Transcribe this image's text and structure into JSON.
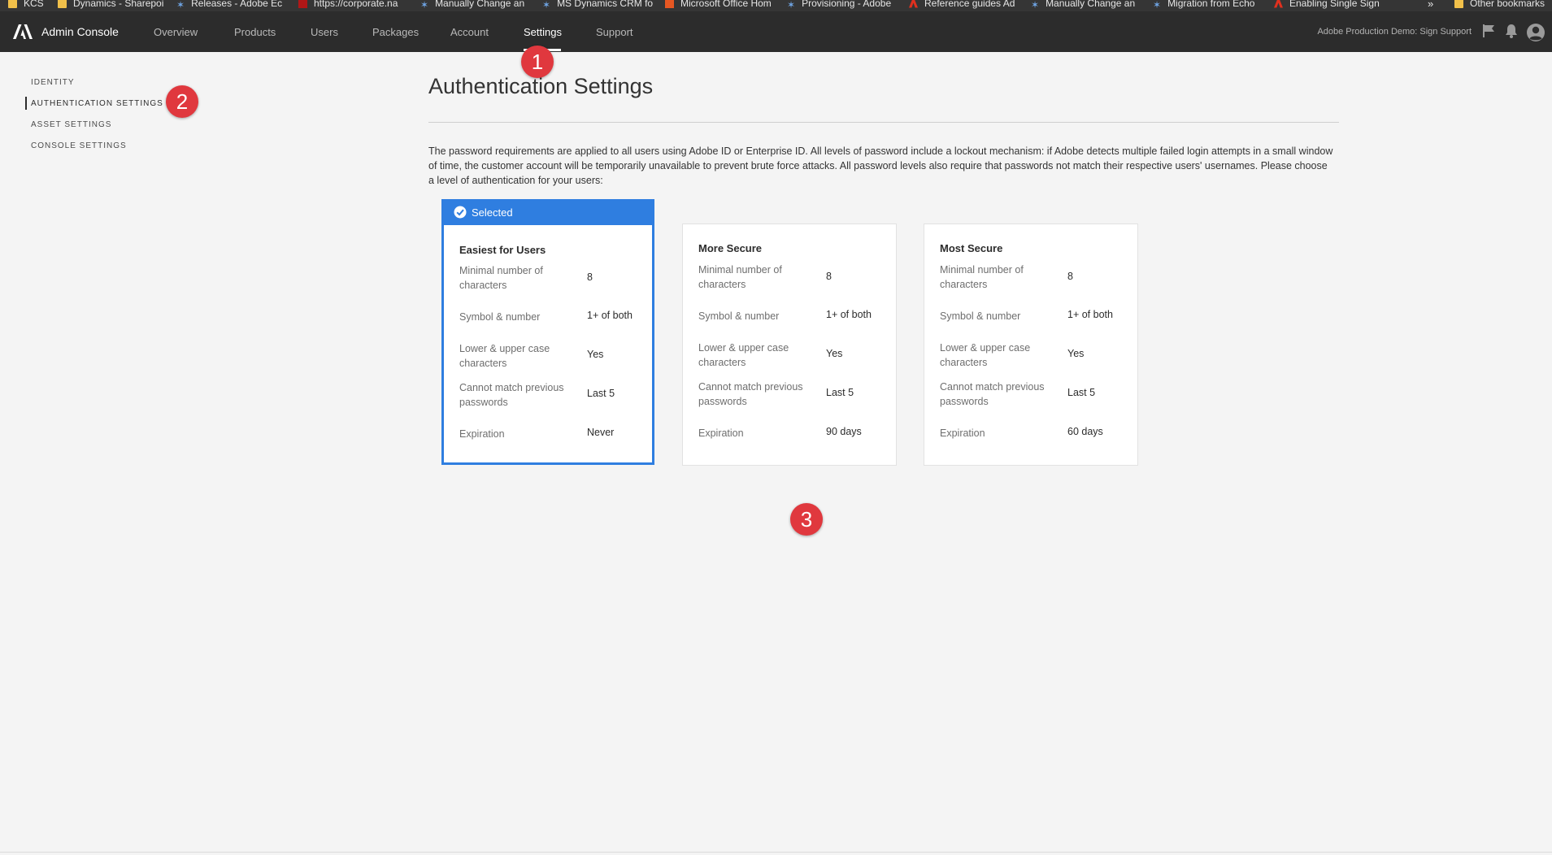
{
  "bookmarks": [
    {
      "label": "KCS",
      "icon": "folder"
    },
    {
      "label": "Dynamics - Sharepoi",
      "icon": "folder"
    },
    {
      "label": "Releases - Adobe Ec",
      "icon": "star"
    },
    {
      "label": "https://corporate.na",
      "icon": "red"
    },
    {
      "label": "Manually Change an",
      "icon": "star"
    },
    {
      "label": "MS Dynamics CRM fo",
      "icon": "star"
    },
    {
      "label": "Microsoft Office Hom",
      "icon": "office"
    },
    {
      "label": "Provisioning - Adobe",
      "icon": "star"
    },
    {
      "label": "Reference guides Ad",
      "icon": "adobe"
    },
    {
      "label": "Manually Change an",
      "icon": "star"
    },
    {
      "label": "Migration from Echo",
      "icon": "star"
    },
    {
      "label": "Enabling Single Sign",
      "icon": "adobe"
    }
  ],
  "bookmarks_more": "»",
  "bookmarks_other": "Other bookmarks",
  "header": {
    "app_title": "Admin Console",
    "nav": [
      "Overview",
      "Products",
      "Users",
      "Packages",
      "Account",
      "Settings",
      "Support"
    ],
    "active_nav": "Settings",
    "org_name": "Adobe Production Demo: Sign Support"
  },
  "sidenav": {
    "items": [
      "IDENTITY",
      "AUTHENTICATION SETTINGS",
      "ASSET SETTINGS",
      "CONSOLE SETTINGS"
    ],
    "active": "AUTHENTICATION SETTINGS"
  },
  "main": {
    "title": "Authentication Settings",
    "intro": "The password requirements are applied to all users using Adobe ID or Enterprise ID. All levels of password include a lockout mechanism: if Adobe detects multiple failed login attempts in a small window of time, the customer account will be temporarily unavailable to prevent brute force attacks. All password levels also require that passwords not match their respective users' usernames. Please choose a level of authentication for your users:",
    "selected_label": "Selected",
    "row_labels": [
      "Minimal number of characters",
      "Symbol & number",
      "Lower & upper case characters",
      "Cannot match previous passwords",
      "Expiration"
    ],
    "cards": [
      {
        "title": "Easiest for Users",
        "selected": true,
        "values": [
          "8",
          "1+ of both",
          "Yes",
          "Last 5",
          "Never"
        ]
      },
      {
        "title": "More Secure",
        "selected": false,
        "values": [
          "8",
          "1+ of both",
          "Yes",
          "Last 5",
          "90 days"
        ]
      },
      {
        "title": "Most Secure",
        "selected": false,
        "values": [
          "8",
          "1+ of both",
          "Yes",
          "Last 5",
          "60 days"
        ]
      }
    ]
  },
  "markers": [
    "1",
    "2",
    "3"
  ],
  "colors": {
    "header_bg": "#2c2c2c",
    "accent": "#2f7ee0",
    "marker": "#e0383e",
    "page_bg": "#f4f4f4"
  }
}
